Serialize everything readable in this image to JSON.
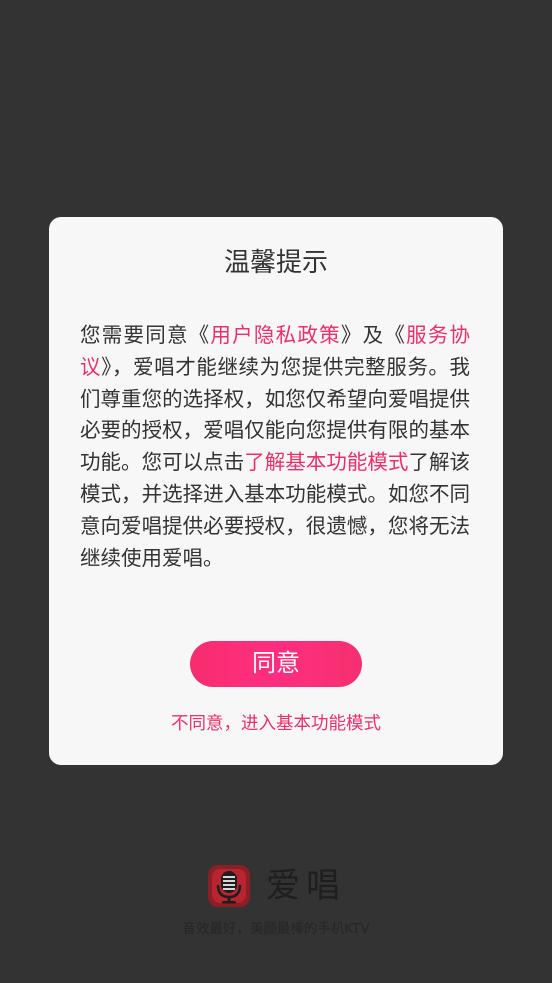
{
  "dialog": {
    "title": "温馨提示",
    "body": {
      "part1": "您需要同意《",
      "privacy_link": "用户隐私政策",
      "part2": "》及《",
      "service_link": "服务协议",
      "part3": "》，爱唱才能继续为您提供完整服务。我们尊重您的选择权，如您仅希望向爱唱提供必要的授权，爱唱仅能向您提供有限的基本功能。您可以点击",
      "basic_mode_link": "了解基本功能模式",
      "part4": "了解该模式，并选择进入基本功能模式。如您不同意向爱唱提供必要授权，很遗憾，您将无法继续使用爱唱。"
    },
    "agree_label": "同意",
    "disagree_label": "不同意，进入基本功能模式"
  },
  "brand": {
    "name": "爱唱",
    "slogan": "音效最好，美颜最棒的手机KTV",
    "logo_icon": "microphone-icon"
  },
  "colors": {
    "background": "#333333",
    "dialog_background": "#f7f7f7",
    "accent": "#e8306a",
    "button_gradient_start": "#f72d6e",
    "button_gradient_end": "#ff2e80",
    "logo_background": "#8a1f26"
  }
}
